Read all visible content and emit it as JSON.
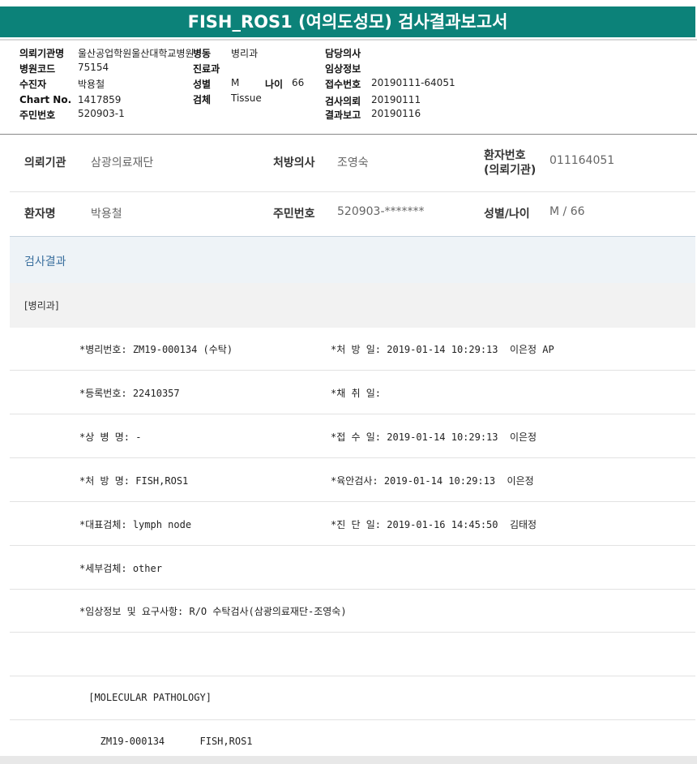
{
  "title": "FISH_ROS1 (여의도성모) 검사결과보고서",
  "header": {
    "col1": [
      {
        "label": "의뢰기관명",
        "value": "울산공업학원울산대학교병원"
      },
      {
        "label": "병원코드",
        "value": "75154"
      },
      {
        "label": "수진자",
        "value": "박용철"
      },
      {
        "label": "Chart No.",
        "value": "1417859"
      },
      {
        "label": "주민번호",
        "value": "520903-1"
      }
    ],
    "col2": [
      {
        "label": "병동",
        "value": "병리과"
      },
      {
        "label": "진료과",
        "value": ""
      },
      {
        "label": "성별",
        "value": "M"
      },
      {
        "label": "검체",
        "value": "Tissue"
      }
    ],
    "age": {
      "label": "나이",
      "value": "66"
    },
    "col3": [
      {
        "label": "담당의사",
        "value": ""
      },
      {
        "label": "임상정보",
        "value": ""
      },
      {
        "label": "접수번호",
        "value": "20190111-64051"
      },
      {
        "label": "검사의뢰",
        "value": "20190111"
      },
      {
        "label": "결과보고",
        "value": "20190116"
      }
    ]
  },
  "info": {
    "row1": [
      {
        "label": "의뢰기관",
        "value": "삼광의료재단"
      },
      {
        "label": "처방의사",
        "value": "조영숙"
      },
      {
        "label_line1": "환자번호",
        "label_line2": "(의뢰기관)",
        "value": "011164051"
      }
    ],
    "row2": [
      {
        "label": "환자명",
        "value": "박용철"
      },
      {
        "label": "주민번호",
        "value": "520903-*******"
      },
      {
        "label": "성별/나이",
        "value": "M / 66"
      }
    ]
  },
  "section_title": "검사결과",
  "dept": "[병리과]",
  "results": [
    {
      "c1": "*병리번호: ZM19-000134 (수탁)",
      "c2": "*처 방 일: 2019-01-14 10:29:13  이은정 AP"
    },
    {
      "c1": "*등록번호: 22410357",
      "c2": "*채 취 일:"
    },
    {
      "c1": "*상 병 명: -",
      "c2": "*접 수 일: 2019-01-14 10:29:13  이은정"
    },
    {
      "c1": "*처 방 명: FISH,ROS1",
      "c2": "*육안검사: 2019-01-14 10:29:13  이은정"
    },
    {
      "c1": "*대표검체: lymph node",
      "c2": "*진 단 일: 2019-01-16 14:45:50  김태정"
    },
    {
      "c1": "*세부검체: other",
      "c2": ""
    },
    {
      "c1": "*임상정보 및 요구사항: R/O 수탁검사(삼광의료재단-조영숙)",
      "c2": ""
    },
    {
      "c1": "",
      "c2": ""
    },
    {
      "c1": " [MOLECULAR PATHOLOGY]",
      "c2": ""
    },
    {
      "c1": "   ZM19-000134      FISH,ROS1",
      "c2": ""
    }
  ]
}
